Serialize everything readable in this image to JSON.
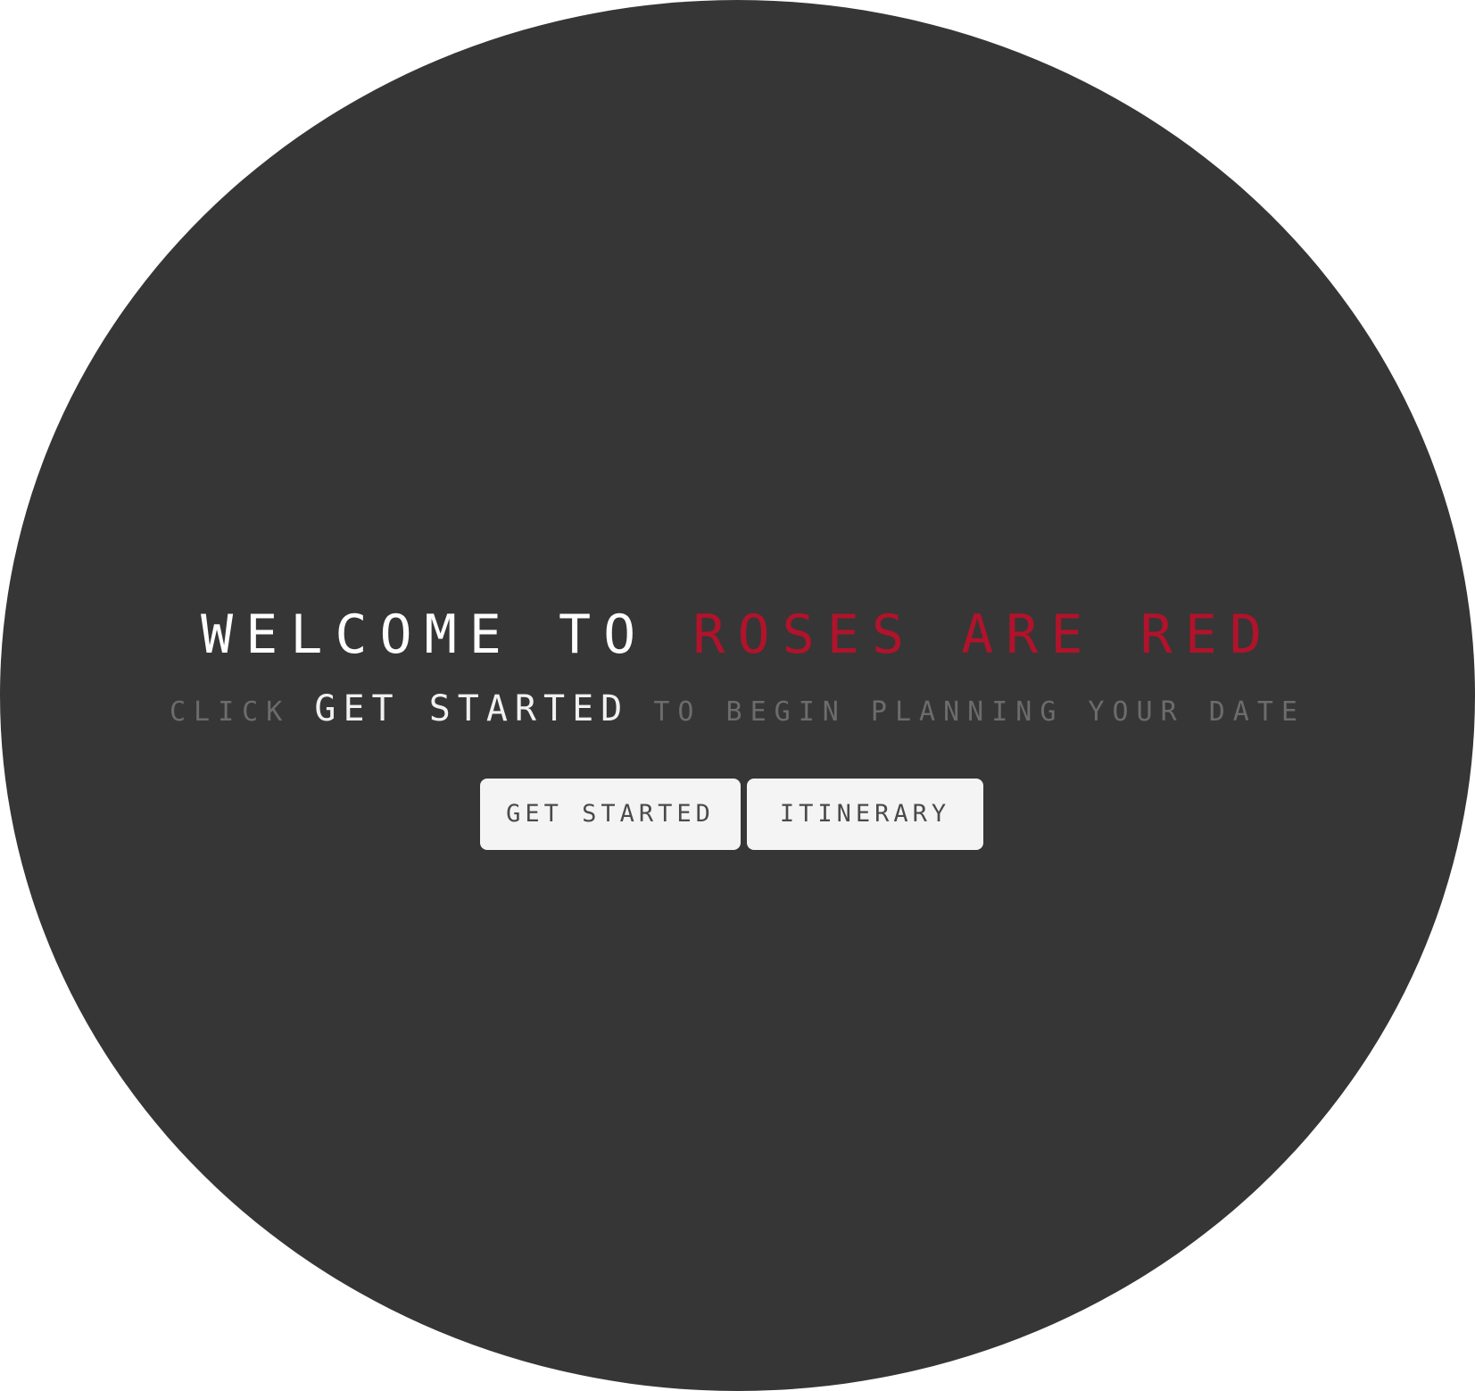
{
  "hero": {
    "title_prefix": "WELCOME TO",
    "title_brand": "ROSES ARE RED",
    "subtitle_before": "CLICK",
    "subtitle_highlight": "GET STARTED",
    "subtitle_after": "TO BEGIN PLANNING YOUR DATE"
  },
  "actions": {
    "get_started_label": "GET STARTED",
    "itinerary_label": "ITINERARY"
  },
  "colors": {
    "background_circle": "#363636",
    "page_background": "#ffffff",
    "brand_red": "#b0132b",
    "title_text": "#ffffff",
    "subtitle_muted": "#6c6c6c",
    "button_background": "#f4f4f4",
    "button_text": "#4a4a4a"
  }
}
